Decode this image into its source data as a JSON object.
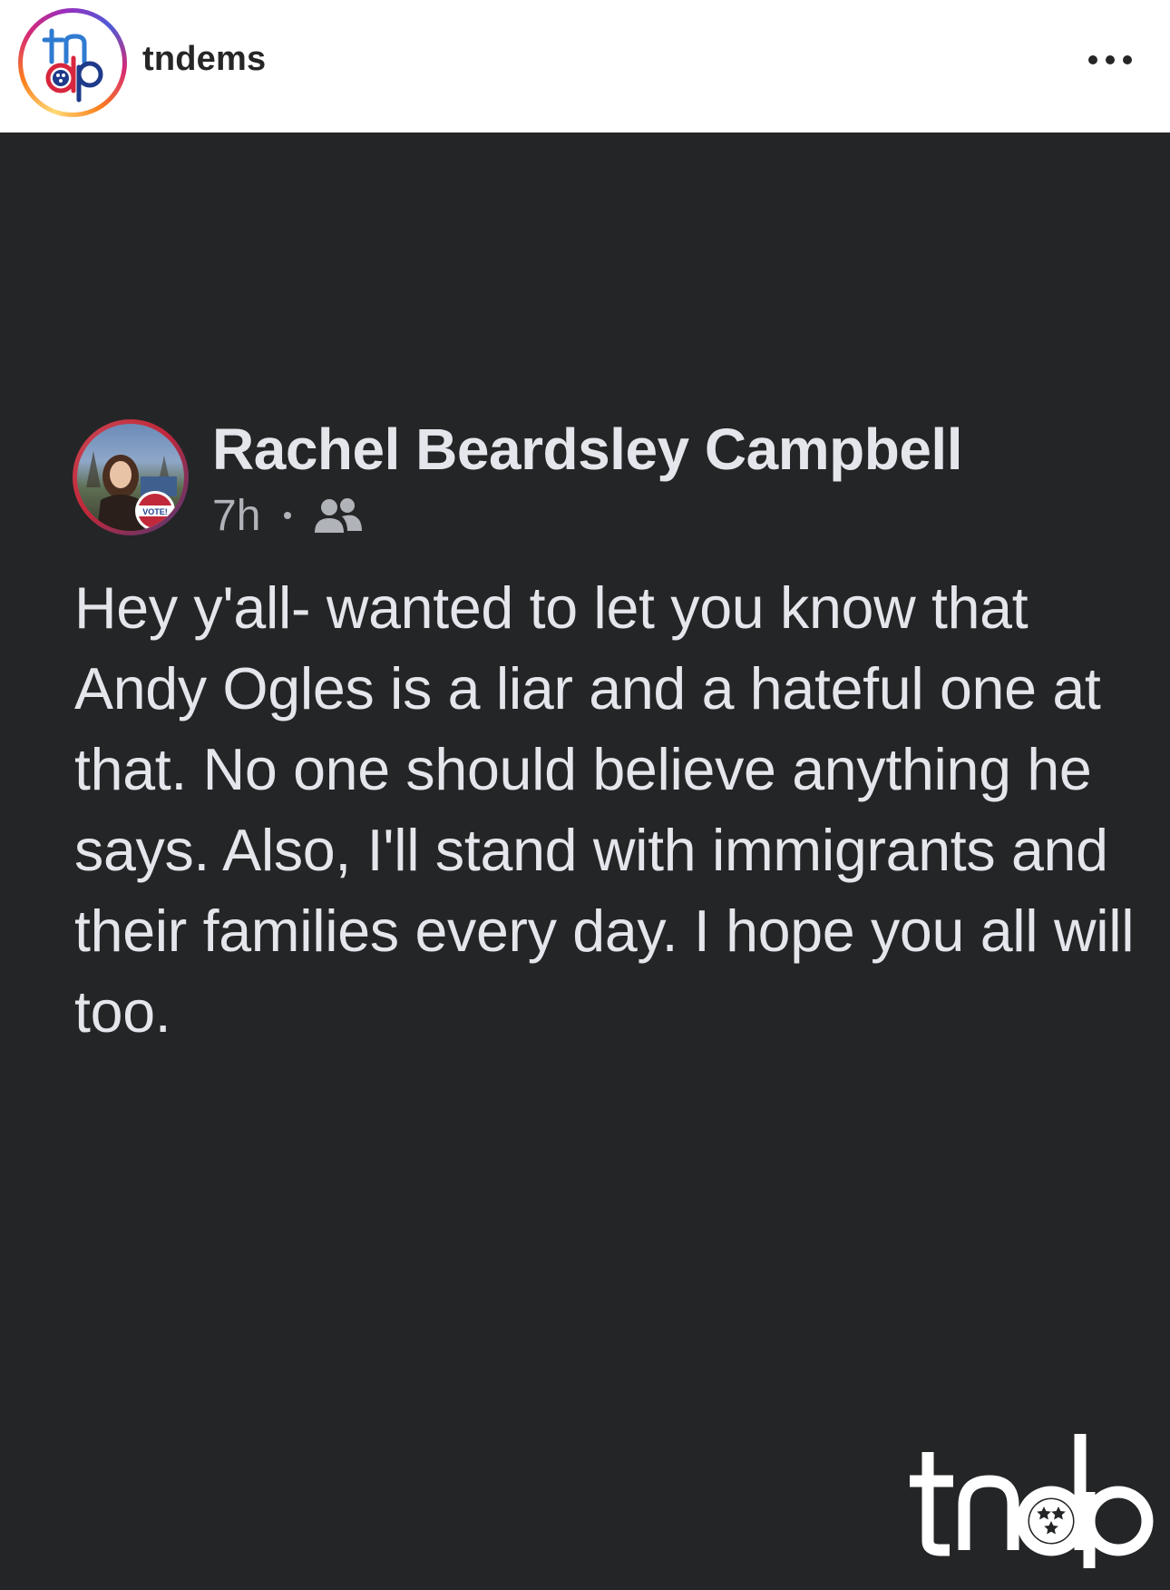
{
  "instagram": {
    "username": "tndems",
    "more_label": "More options",
    "avatar_logo_text": "tndp"
  },
  "post": {
    "author": "Rachel Beardsley Campbell",
    "time": "7h",
    "audience_icon": "friends-icon",
    "body": "Hey y'all- wanted to let you know that Andy Ogles is a liar and a hateful one at that. No one should believe anything he says. Also, I'll stand with immigrants and their families every day. I hope you all will too.",
    "avatar_badge_text": "VOTE!"
  },
  "watermark": {
    "logo_text": "tndp"
  },
  "colors": {
    "post_background": "#242526",
    "post_text": "#e4e6eb",
    "meta_text": "#b0b3b8",
    "ig_text": "#262626",
    "tndp_red": "#d7263d",
    "tndp_blue": "#1e3a8a"
  }
}
